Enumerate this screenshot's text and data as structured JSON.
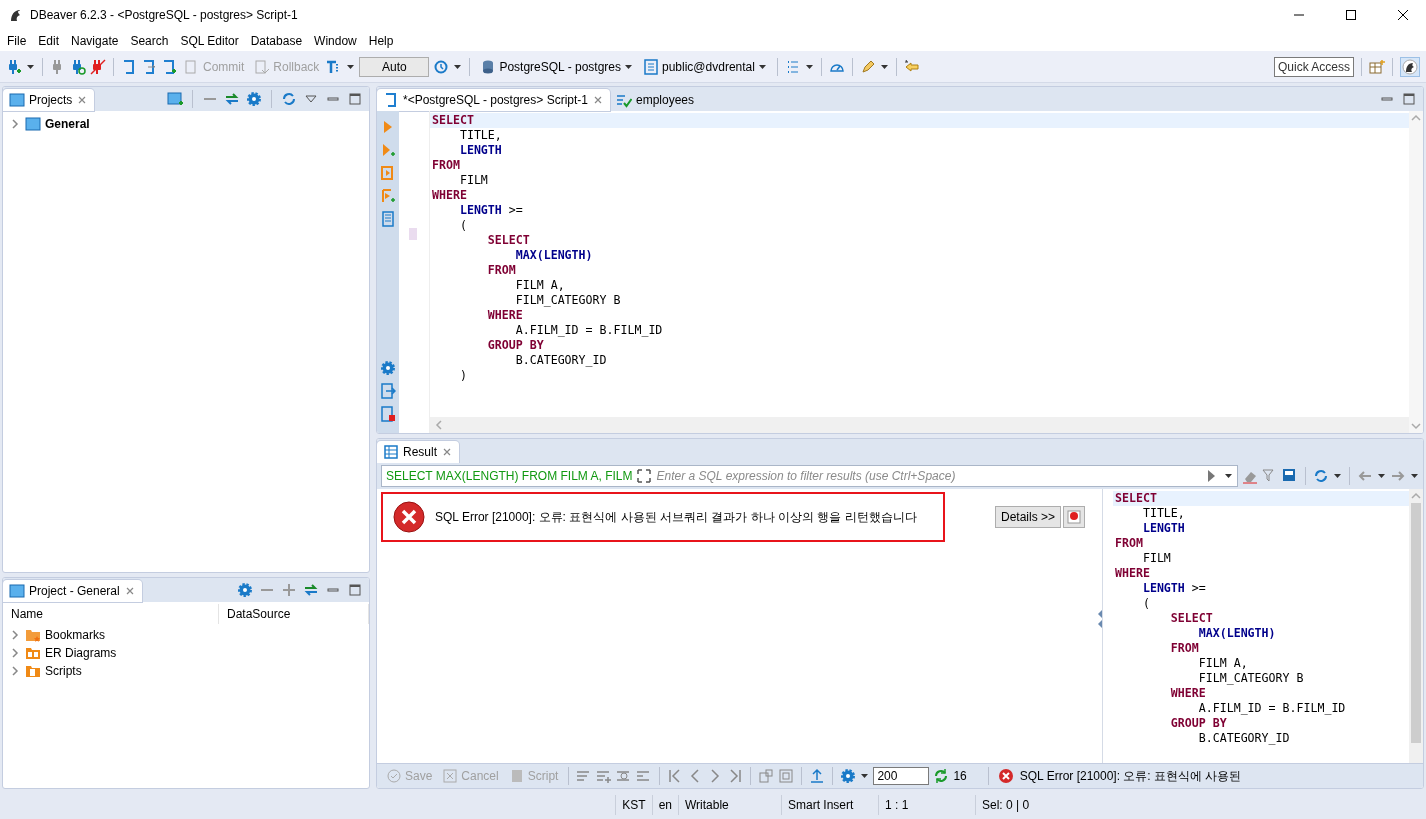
{
  "window": {
    "title": "DBeaver 6.2.3 - <PostgreSQL - postgres> Script-1"
  },
  "menu": [
    "File",
    "Edit",
    "Navigate",
    "Search",
    "SQL Editor",
    "Database",
    "Window",
    "Help"
  ],
  "toolbar": {
    "commit": {
      "label": "Commit",
      "disabled": true
    },
    "rollback": {
      "label": "Rollback",
      "disabled": true
    },
    "transaction_mode": "Auto",
    "connection": "PostgreSQL - postgres",
    "schema": "public@dvdrental",
    "quick_access": "Quick Access"
  },
  "projects_panel": {
    "tab": "Projects",
    "tree": [
      {
        "label": "General",
        "expanded": false
      }
    ]
  },
  "project_panel": {
    "tab": "Project - General",
    "columns": [
      "Name",
      "DataSource"
    ],
    "rows": [
      {
        "label": "Bookmarks",
        "kind": "bookmarks",
        "expanded": false
      },
      {
        "label": "ER Diagrams",
        "kind": "diagrams",
        "expanded": false
      },
      {
        "label": "Scripts",
        "kind": "scripts",
        "expanded": false
      }
    ]
  },
  "editor": {
    "tabs": [
      {
        "label": "*<PostgreSQL - postgres> Script-1",
        "kind": "script",
        "selected": true
      },
      {
        "label": "employees",
        "kind": "table",
        "selected": false
      }
    ],
    "lines": [
      [
        {
          "text": "SELECT",
          "kind": "keyword"
        }
      ],
      [
        {
          "text": "    TITLE,",
          "kind": "plain"
        }
      ],
      [
        {
          "text": "    LENGTH",
          "kind": "function"
        }
      ],
      [
        {
          "text": "FROM",
          "kind": "keyword"
        }
      ],
      [
        {
          "text": "    FILM",
          "kind": "plain"
        }
      ],
      [
        {
          "text": "WHERE",
          "kind": "keyword"
        }
      ],
      [
        {
          "text": "    LENGTH",
          "kind": "function"
        },
        {
          "text": " >=",
          "kind": "plain"
        }
      ],
      [
        {
          "text": "    (",
          "kind": "plain"
        }
      ],
      [
        {
          "text": "        SELECT",
          "kind": "keyword"
        }
      ],
      [
        {
          "text": "            MAX(LENGTH)",
          "kind": "function"
        }
      ],
      [
        {
          "text": "        FROM",
          "kind": "keyword"
        }
      ],
      [
        {
          "text": "            FILM A,",
          "kind": "plain"
        }
      ],
      [
        {
          "text": "            FILM_CATEGORY B",
          "kind": "plain"
        }
      ],
      [
        {
          "text": "        WHERE",
          "kind": "keyword"
        }
      ],
      [
        {
          "text": "            A.FILM_ID = B.FILM_ID",
          "kind": "plain"
        }
      ],
      [
        {
          "text": "        GROUP BY",
          "kind": "keyword"
        }
      ],
      [
        {
          "text": "            B.CATEGORY_ID",
          "kind": "plain"
        }
      ],
      [
        {
          "text": "    )",
          "kind": "plain"
        }
      ]
    ]
  },
  "result": {
    "tab": "Result",
    "query": "SELECT MAX(LENGTH) FROM FILM A, FILM",
    "filter_placeholder": "Enter a SQL expression to filter results (use Ctrl+Space)",
    "error": "SQL Error [21000]: 오류: 표현식에 사용된 서브쿼리 결과가 하나 이상의 행을 리턴했습니다",
    "details_button": "Details >>",
    "preview_lines": [
      [
        {
          "text": "SELECT",
          "kind": "keyword"
        }
      ],
      [
        {
          "text": "    TITLE,",
          "kind": "plain"
        }
      ],
      [
        {
          "text": "    LENGTH",
          "kind": "function"
        }
      ],
      [
        {
          "text": "FROM",
          "kind": "keyword"
        }
      ],
      [
        {
          "text": "    FILM",
          "kind": "plain"
        }
      ],
      [
        {
          "text": "WHERE",
          "kind": "keyword"
        }
      ],
      [
        {
          "text": "    LENGTH",
          "kind": "function"
        },
        {
          "text": " >=",
          "kind": "plain"
        }
      ],
      [
        {
          "text": "    (",
          "kind": "plain"
        }
      ],
      [
        {
          "text": "        SELECT",
          "kind": "keyword"
        }
      ],
      [
        {
          "text": "            MAX(LENGTH)",
          "kind": "function"
        }
      ],
      [
        {
          "text": "        FROM",
          "kind": "keyword"
        }
      ],
      [
        {
          "text": "            FILM A,",
          "kind": "plain"
        }
      ],
      [
        {
          "text": "            FILM_CATEGORY B",
          "kind": "plain"
        }
      ],
      [
        {
          "text": "        WHERE",
          "kind": "keyword"
        }
      ],
      [
        {
          "text": "            A.FILM_ID = B.FILM_ID",
          "kind": "plain"
        }
      ],
      [
        {
          "text": "        GROUP BY",
          "kind": "keyword"
        }
      ],
      [
        {
          "text": "            B.CATEGORY_ID",
          "kind": "plain"
        }
      ]
    ],
    "footer": {
      "save": {
        "label": "Save",
        "disabled": true
      },
      "cancel": {
        "label": "Cancel",
        "disabled": true
      },
      "script": {
        "label": "Script",
        "disabled": true
      },
      "fetch_size": "200",
      "row_count": "16",
      "status": "SQL Error [21000]: 오류: 표현식에 사용된"
    }
  },
  "status_bar": [
    "KST",
    "en",
    "Writable",
    "Smart Insert",
    "1 : 1",
    "Sel: 0 | 0"
  ]
}
